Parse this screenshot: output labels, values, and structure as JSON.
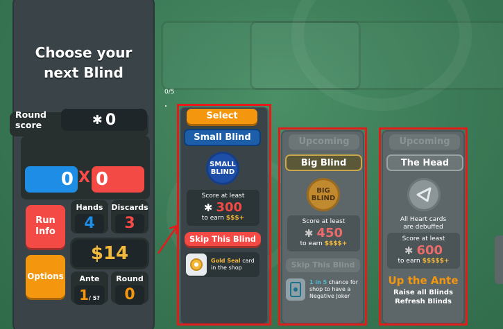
{
  "sidebar": {
    "title_line1": "Choose your",
    "title_line2": "next Blind",
    "round_score_label_1": "Round",
    "round_score_label_2": "score",
    "round_score_value": "0",
    "chips": "0",
    "mult_sign": "X",
    "mult": "0",
    "run_info_line1": "Run",
    "run_info_line2": "Info",
    "options_label": "Options",
    "hands_label": "Hands",
    "hands_value": "4",
    "discards_label": "Discards",
    "discards_value": "3",
    "money": "$14",
    "ante_label": "Ante",
    "ante_value": "1",
    "ante_max": "/ 5?",
    "round_label": "Round",
    "round_value": "0"
  },
  "progress_text": "0/5",
  "blinds": {
    "small": {
      "status": "Select",
      "name": "Small Blind",
      "token_line1": "SMALL",
      "token_line2": "BLIND",
      "score_label": "Score at least",
      "score_value": "300",
      "earn_label": "to earn",
      "earn_value": "$$$+",
      "skip_label": "Skip This Blind",
      "tag_highlight": "Gold Seal",
      "tag_rest_1": " card",
      "tag_rest_2": "in the shop"
    },
    "big": {
      "status": "Upcoming",
      "name": "Big Blind",
      "token_line1": "BIG",
      "token_line2": "BLIND",
      "score_label": "Score at least",
      "score_value": "450",
      "earn_label": "to earn",
      "earn_value": "$$$$+",
      "skip_label": "Skip This Blind",
      "tag_highlight": "1 in 5",
      "tag_rest_1": " chance for",
      "tag_rest_2": "shop to have a",
      "tag_rest_3": "Negative Joker"
    },
    "boss": {
      "status": "Upcoming",
      "name": "The Head",
      "desc_line1": "All Heart cards",
      "desc_line2": "are debuffed",
      "score_label": "Score at least",
      "score_value": "600",
      "earn_label": "to earn",
      "earn_value": "$$$$$+",
      "ante_up": "Up the Ante",
      "ante_desc1": "Raise all Blinds",
      "ante_desc2": "Refresh Blinds"
    }
  },
  "colors": {
    "chips": "#1e8de6",
    "mult": "#f34a46",
    "money": "#f3b83a",
    "select": "#f5960f",
    "small_blind_name": "#1c5fa8",
    "highlight": "#e31b1b"
  }
}
